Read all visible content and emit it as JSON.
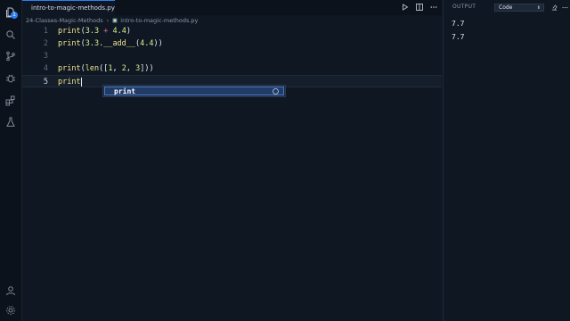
{
  "colors": {
    "accent": "#2d7ef7",
    "background": "#0f1722",
    "keyword": "#efe58c",
    "number": "#d7ef8c",
    "operator": "#e06c9f"
  },
  "activity_bar": {
    "icons": [
      "files-icon",
      "search-icon",
      "source-control-icon",
      "debug-icon",
      "extensions-icon",
      "test-flask-icon",
      "account-icon",
      "settings-gear-icon"
    ],
    "source_control_badge": "1"
  },
  "tab": {
    "label": "intro-to-magic-methods.py",
    "modified": true
  },
  "tab_actions": [
    "run-icon",
    "split-editor-icon",
    "more-actions-icon"
  ],
  "breadcrumb": {
    "folder": "24-Classes-Magic-Methods",
    "file": "intro-to-magic-methods.py"
  },
  "code": {
    "lines": [
      {
        "number": "1",
        "tokens": [
          [
            "kw",
            "print"
          ],
          [
            "par",
            "("
          ],
          [
            "num",
            "3.3"
          ],
          [
            "par",
            " "
          ],
          [
            "op",
            "+"
          ],
          [
            "par",
            " "
          ],
          [
            "num",
            "4.4"
          ],
          [
            "par",
            ")"
          ]
        ]
      },
      {
        "number": "2",
        "tokens": [
          [
            "kw",
            "print"
          ],
          [
            "par",
            "("
          ],
          [
            "num",
            "3.3"
          ],
          [
            "par",
            "."
          ],
          [
            "kw",
            "__add__"
          ],
          [
            "par",
            "("
          ],
          [
            "num",
            "4.4"
          ],
          [
            "par",
            "))"
          ]
        ]
      },
      {
        "number": "3",
        "tokens": []
      },
      {
        "number": "4",
        "tokens": [
          [
            "kw",
            "print"
          ],
          [
            "par",
            "("
          ],
          [
            "kw",
            "len"
          ],
          [
            "par",
            "(["
          ],
          [
            "num",
            "1"
          ],
          [
            "par",
            ", "
          ],
          [
            "num",
            "2"
          ],
          [
            "par",
            ", "
          ],
          [
            "num",
            "3"
          ],
          [
            "par",
            "]))"
          ]
        ]
      },
      {
        "number": "5",
        "tokens": [
          [
            "kw",
            "print"
          ]
        ]
      }
    ],
    "active_line": "5"
  },
  "suggestion": {
    "label": "print"
  },
  "output": {
    "title": "OUTPUT",
    "channel": "Code",
    "lines": [
      "7.7",
      "7.7"
    ]
  }
}
